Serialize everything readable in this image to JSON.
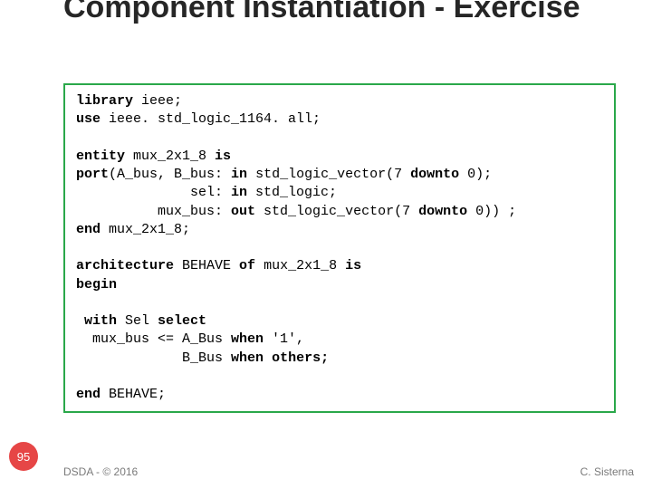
{
  "title": "Component Instantiation -\nExercise",
  "code": {
    "l1a": "library",
    "l1b": " ieee;",
    "l2a": "use",
    "l2b": " ieee. std_logic_1164. all;",
    "l3a": "entity",
    "l3b": " mux_2x1_8 ",
    "l3c": "is",
    "l4a": "port",
    "l4b": "(A_bus, B_bus: ",
    "l4c": "in",
    "l4d": " std_logic_vector(7 ",
    "l4e": "downto",
    "l4f": " 0);",
    "l5a": "              sel: ",
    "l5b": "in",
    "l5c": " std_logic;",
    "l6a": "          mux_bus: ",
    "l6b": "out",
    "l6c": " std_logic_vector(7 ",
    "l6d": "downto",
    "l6e": " 0)) ;",
    "l7a": "end",
    "l7b": " mux_2x1_8;",
    "l8a": "architecture",
    "l8b": " BEHAVE ",
    "l8c": "of",
    "l8d": " mux_2x1_8 ",
    "l8e": "is",
    "l9a": "begin",
    "l10a": " with",
    "l10b": " Sel ",
    "l10c": "select",
    "l11a": "  mux_bus <= A_Bus ",
    "l11b": "when",
    "l11c": " '1',",
    "l12a": "             B_Bus ",
    "l12b": "when",
    "l12c": " ",
    "l12d": "others;",
    "l13a": "end",
    "l13b": " BEHAVE;"
  },
  "page_number": "95",
  "footer_left": "DSDA - © 2016",
  "footer_right": "C. Sisterna"
}
